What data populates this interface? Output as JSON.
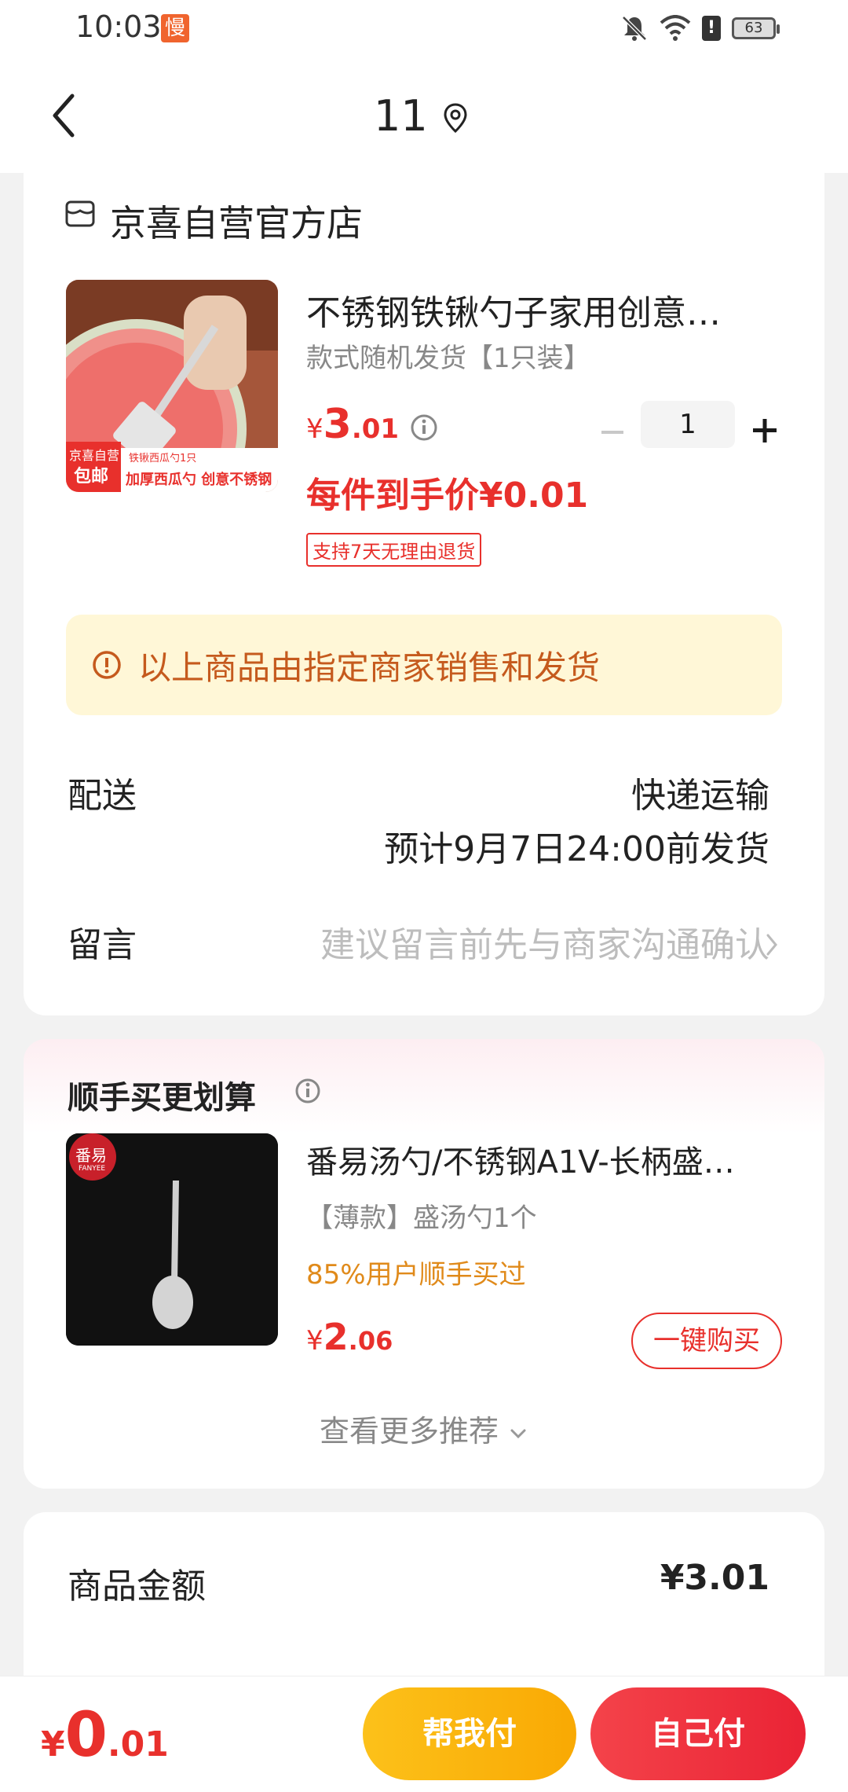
{
  "status_bar": {
    "time": "10:03",
    "app_badge": "慢",
    "battery": "63",
    "alert": "!"
  },
  "nav": {
    "title": "11"
  },
  "order": {
    "store_name": "京喜自营官方店",
    "product": {
      "title": "不锈钢铁锹勺子家用创意…",
      "variant": "款式随机发货【1只装】",
      "price_yen": "¥",
      "price_int": "3",
      "price_dec": ".01",
      "quantity": "1",
      "per_item_price": "每件到手价¥0.01",
      "return_tag": "支持7天无理由退货",
      "thumb_badge_top": "京喜自营",
      "thumb_badge_bottom": "包邮",
      "thumb_caption_small": "铁锹西瓜勺1只",
      "thumb_caption": "加厚西瓜勺 创意不锈钢"
    },
    "notice": "以上商品由指定商家销售和发货",
    "delivery": {
      "label": "配送",
      "method": "快递运输",
      "estimate": "预计9月7日24:00前发货"
    },
    "message": {
      "label": "留言",
      "placeholder": "建议留言前先与商家沟通确认"
    }
  },
  "recommend": {
    "title": "顺手买更划算",
    "product": {
      "title": "番易汤勺/不锈钢A1V-长柄盛…",
      "variant": "【薄款】盛汤勺1个",
      "social_proof": "85%用户顺手买过",
      "price_yen": "¥",
      "price_int": "2",
      "price_dec": ".06",
      "buy_label": "一键购买",
      "brand_badge": "番易",
      "brand_badge_sub": "FANYEE"
    },
    "more_label": "查看更多推荐"
  },
  "summary": {
    "goods_amount_label": "商品金额",
    "goods_amount_value": "¥3.01"
  },
  "bottom_bar": {
    "total_yen": "¥",
    "total_int": "0",
    "total_dec": ".01",
    "help_pay_label": "帮我付",
    "self_pay_label": "自己付"
  },
  "colors": {
    "accent_red": "#e8302c",
    "notice_bg": "#fff7d7",
    "notice_text": "#c55a1d",
    "orange_text": "#e08a1a",
    "help_pay_yellow": "#fcb712",
    "self_pay_red": "#ee2f3e"
  },
  "icons": [
    "back-chevron-icon",
    "location-pin-icon",
    "store-icon",
    "info-icon",
    "minus-icon",
    "plus-icon",
    "chevron-right-icon",
    "chevron-down-icon",
    "bell-off-icon",
    "wifi-icon",
    "battery-icon"
  ]
}
